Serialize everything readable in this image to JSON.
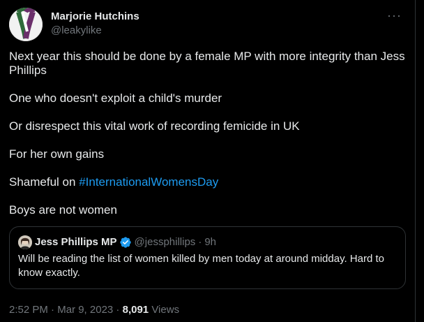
{
  "author": {
    "display_name": "Marjorie Hutchins",
    "handle": "@leakylike",
    "avatar_icon": "suffragette-ribbon-avatar"
  },
  "more_icon": "···",
  "body": {
    "p1": "Next year this should be done by a female MP with more integrity than Jess Phillips",
    "p2": "One who doesn't exploit a child's murder",
    "p3": "Or disrespect this vital work of recording femicide in UK",
    "p4": "For her own gains",
    "p5_prefix": "Shameful on ",
    "p5_hashtag": "#InternationalWomensDay",
    "p6": "Boys are not women"
  },
  "quote": {
    "display_name": "Jess Phillips MP",
    "handle": "@jessphillips",
    "separator": "·",
    "time": "9h",
    "text": "Will be reading the list of women killed by men today at around midday. Hard to know exactly.",
    "verified_icon": "verified-badge-icon"
  },
  "meta": {
    "time": "2:52 PM",
    "sep1": " · ",
    "date": "Mar 9, 2023",
    "sep2": " · ",
    "views_count": "8,091",
    "views_label": " Views"
  },
  "colors": {
    "background": "#000000",
    "text": "#e7e9ea",
    "muted": "#71767b",
    "link": "#1d9bf0",
    "border": "#2f3336",
    "verified": "#1d9bf0"
  }
}
